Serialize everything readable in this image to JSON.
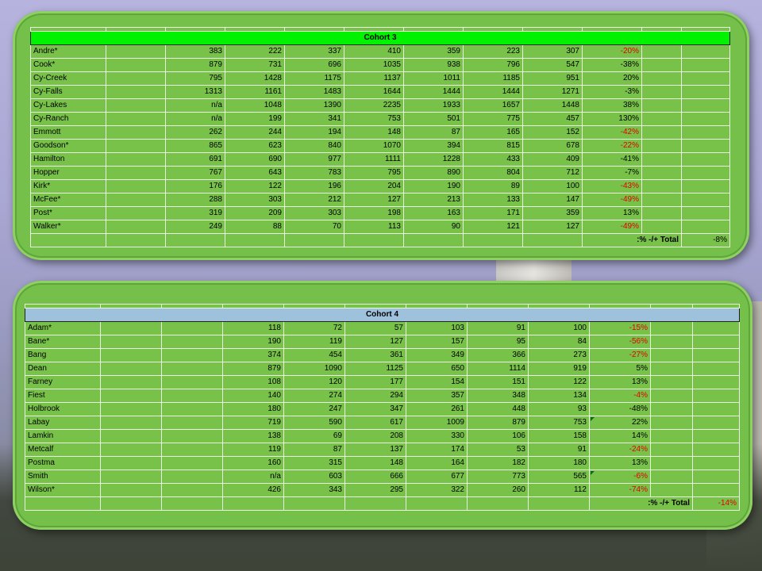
{
  "cohort3": {
    "title": "Cohort 3",
    "rows": [
      {
        "name": "Andre*",
        "values": [
          "383",
          "222",
          "337",
          "410",
          "359",
          "223",
          "307"
        ],
        "pct": "-20%",
        "neg": true
      },
      {
        "name": "Cook*",
        "values": [
          "879",
          "731",
          "696",
          "1035",
          "938",
          "796",
          "547"
        ],
        "pct": "-38%",
        "neg": false
      },
      {
        "name": "Cy-Creek",
        "values": [
          "795",
          "1428",
          "1175",
          "1137",
          "1011",
          "1185",
          "951"
        ],
        "pct": "20%",
        "neg": false
      },
      {
        "name": "Cy-Falls",
        "values": [
          "1313",
          "1161",
          "1483",
          "1644",
          "1444",
          "1444",
          "1271"
        ],
        "pct": "-3%",
        "neg": false
      },
      {
        "name": "Cy-Lakes",
        "values": [
          "n/a",
          "1048",
          "1390",
          "2235",
          "1933",
          "1657",
          "1448"
        ],
        "pct": "38%",
        "neg": false
      },
      {
        "name": "Cy-Ranch",
        "values": [
          "n/a",
          "199",
          "341",
          "753",
          "501",
          "775",
          "457"
        ],
        "pct": "130%",
        "neg": false
      },
      {
        "name": "Emmott",
        "values": [
          "262",
          "244",
          "194",
          "148",
          "87",
          "165",
          "152"
        ],
        "pct": "-42%",
        "neg": true
      },
      {
        "name": "Goodson*",
        "values": [
          "865",
          "623",
          "840",
          "1070",
          "394",
          "815",
          "678"
        ],
        "pct": "-22%",
        "neg": true
      },
      {
        "name": "Hamilton",
        "values": [
          "691",
          "690",
          "977",
          "1111",
          "1228",
          "433",
          "409"
        ],
        "pct": "-41%",
        "neg": false
      },
      {
        "name": "Hopper",
        "values": [
          "767",
          "643",
          "783",
          "795",
          "890",
          "804",
          "712"
        ],
        "pct": "-7%",
        "neg": false
      },
      {
        "name": "Kirk*",
        "values": [
          "176",
          "122",
          "196",
          "204",
          "190",
          "89",
          "100"
        ],
        "pct": "-43%",
        "neg": true
      },
      {
        "name": "McFee*",
        "values": [
          "288",
          "303",
          "212",
          "127",
          "213",
          "133",
          "147"
        ],
        "pct": "-49%",
        "neg": true
      },
      {
        "name": "Post*",
        "values": [
          "319",
          "209",
          "303",
          "198",
          "163",
          "171",
          "359"
        ],
        "pct": "13%",
        "neg": false
      },
      {
        "name": "Walker*",
        "values": [
          "249",
          "88",
          "70",
          "113",
          "90",
          "121",
          "127"
        ],
        "pct": "-49%",
        "neg": true
      }
    ],
    "total_label": "Total +/- %:",
    "total_value": "-8%"
  },
  "cohort4": {
    "title": "Cohort 4",
    "rows": [
      {
        "name": "Adam*",
        "values": [
          "118",
          "72",
          "57",
          "103",
          "91",
          "100"
        ],
        "pct": "-15%",
        "neg": true,
        "mark": false
      },
      {
        "name": "Bane*",
        "values": [
          "190",
          "119",
          "127",
          "157",
          "95",
          "84"
        ],
        "pct": "-56%",
        "neg": true,
        "mark": false
      },
      {
        "name": "Bang",
        "values": [
          "374",
          "454",
          "361",
          "349",
          "366",
          "273"
        ],
        "pct": "-27%",
        "neg": true,
        "mark": false
      },
      {
        "name": "Dean",
        "values": [
          "879",
          "1090",
          "1125",
          "650",
          "1114",
          "919"
        ],
        "pct": "5%",
        "neg": false,
        "mark": false
      },
      {
        "name": "Farney",
        "values": [
          "108",
          "120",
          "177",
          "154",
          "151",
          "122"
        ],
        "pct": "13%",
        "neg": false,
        "mark": false
      },
      {
        "name": "Fiest",
        "values": [
          "140",
          "274",
          "294",
          "357",
          "348",
          "134"
        ],
        "pct": "-4%",
        "neg": true,
        "mark": false
      },
      {
        "name": "Holbrook",
        "values": [
          "180",
          "247",
          "347",
          "261",
          "448",
          "93"
        ],
        "pct": "-48%",
        "neg": false,
        "mark": false
      },
      {
        "name": "Labay",
        "values": [
          "719",
          "590",
          "617",
          "1009",
          "879",
          "753"
        ],
        "pct": "22%",
        "neg": false,
        "mark": true
      },
      {
        "name": "Lamkin",
        "values": [
          "138",
          "69",
          "208",
          "330",
          "106",
          "158"
        ],
        "pct": "14%",
        "neg": false,
        "mark": false
      },
      {
        "name": "Metcalf",
        "values": [
          "119",
          "87",
          "137",
          "174",
          "53",
          "91"
        ],
        "pct": "-24%",
        "neg": true,
        "mark": false
      },
      {
        "name": "Postma",
        "values": [
          "160",
          "315",
          "148",
          "164",
          "182",
          "180"
        ],
        "pct": "13%",
        "neg": false,
        "mark": false
      },
      {
        "name": "Smith",
        "values": [
          "n/a",
          "603",
          "666",
          "677",
          "773",
          "565"
        ],
        "pct": "-6%",
        "neg": true,
        "mark": true
      },
      {
        "name": "Wilson*",
        "values": [
          "426",
          "343",
          "295",
          "322",
          "260",
          "112"
        ],
        "pct": "-74%",
        "neg": true,
        "mark": false
      }
    ],
    "total_label": "Total +/- %:",
    "total_value": "-14%"
  }
}
